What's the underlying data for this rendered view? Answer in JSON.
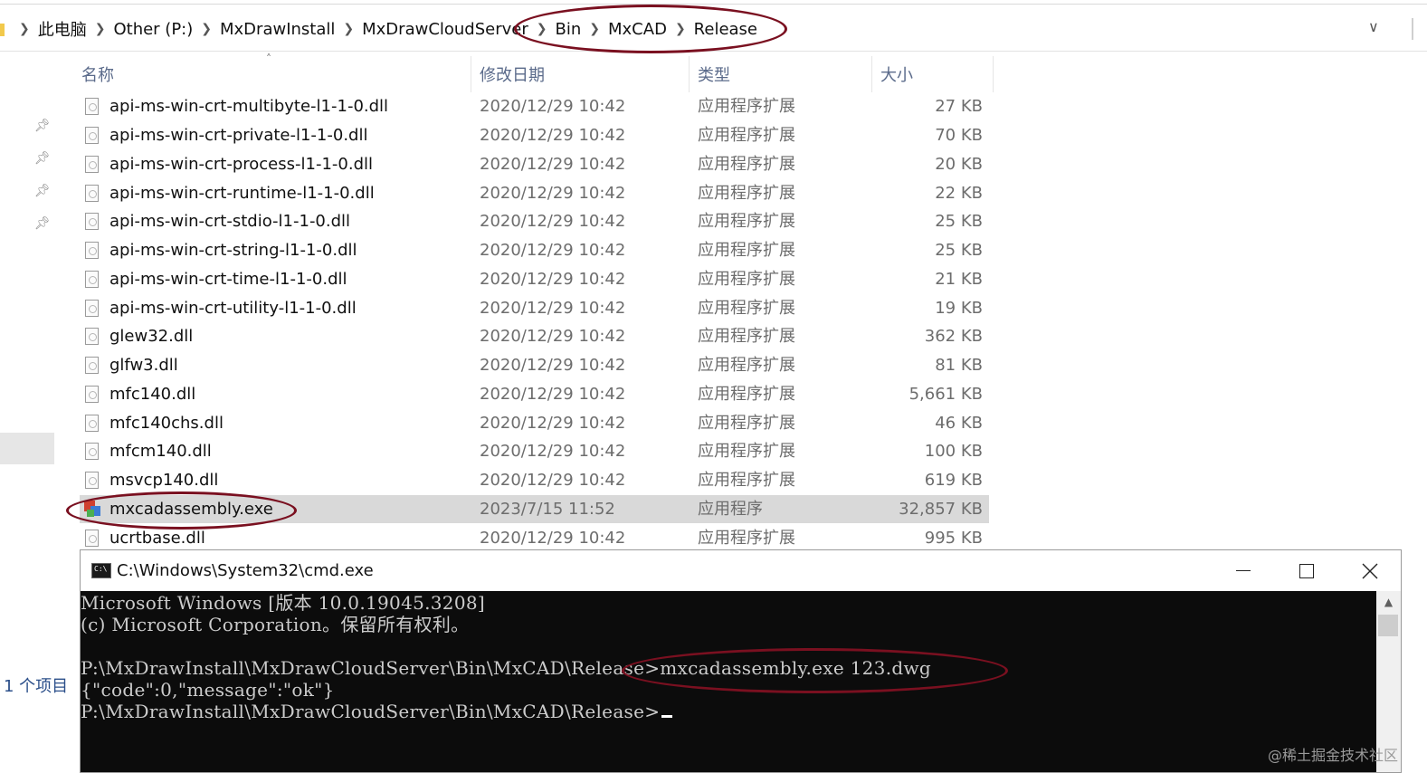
{
  "explorer": {
    "breadcrumb": [
      "此电脑",
      "Other (P:)",
      "MxDrawInstall",
      "MxDrawCloudServer",
      "Bin",
      "MxCAD",
      "Release"
    ],
    "columns": {
      "name": "名称",
      "date": "修改日期",
      "type": "类型",
      "size": "大小"
    },
    "files": [
      {
        "name": "api-ms-win-crt-multibyte-l1-1-0.dll",
        "date": "2020/12/29 10:42",
        "type": "应用程序扩展",
        "size": "27 KB"
      },
      {
        "name": "api-ms-win-crt-private-l1-1-0.dll",
        "date": "2020/12/29 10:42",
        "type": "应用程序扩展",
        "size": "70 KB"
      },
      {
        "name": "api-ms-win-crt-process-l1-1-0.dll",
        "date": "2020/12/29 10:42",
        "type": "应用程序扩展",
        "size": "20 KB"
      },
      {
        "name": "api-ms-win-crt-runtime-l1-1-0.dll",
        "date": "2020/12/29 10:42",
        "type": "应用程序扩展",
        "size": "22 KB"
      },
      {
        "name": "api-ms-win-crt-stdio-l1-1-0.dll",
        "date": "2020/12/29 10:42",
        "type": "应用程序扩展",
        "size": "25 KB"
      },
      {
        "name": "api-ms-win-crt-string-l1-1-0.dll",
        "date": "2020/12/29 10:42",
        "type": "应用程序扩展",
        "size": "25 KB"
      },
      {
        "name": "api-ms-win-crt-time-l1-1-0.dll",
        "date": "2020/12/29 10:42",
        "type": "应用程序扩展",
        "size": "21 KB"
      },
      {
        "name": "api-ms-win-crt-utility-l1-1-0.dll",
        "date": "2020/12/29 10:42",
        "type": "应用程序扩展",
        "size": "19 KB"
      },
      {
        "name": "glew32.dll",
        "date": "2020/12/29 10:42",
        "type": "应用程序扩展",
        "size": "362 KB"
      },
      {
        "name": "glfw3.dll",
        "date": "2020/12/29 10:42",
        "type": "应用程序扩展",
        "size": "81 KB"
      },
      {
        "name": "mfc140.dll",
        "date": "2020/12/29 10:42",
        "type": "应用程序扩展",
        "size": "5,661 KB"
      },
      {
        "name": "mfc140chs.dll",
        "date": "2020/12/29 10:42",
        "type": "应用程序扩展",
        "size": "46 KB"
      },
      {
        "name": "mfcm140.dll",
        "date": "2020/12/29 10:42",
        "type": "应用程序扩展",
        "size": "100 KB"
      },
      {
        "name": "msvcp140.dll",
        "date": "2020/12/29 10:42",
        "type": "应用程序扩展",
        "size": "619 KB"
      },
      {
        "name": "mxcadassembly.exe",
        "date": "2023/7/15 11:52",
        "type": "应用程序",
        "size": "32,857 KB",
        "selected": true
      },
      {
        "name": "ucrtbase.dll",
        "date": "2020/12/29 10:42",
        "type": "应用程序扩展",
        "size": "995 KB"
      }
    ],
    "status": "1 个项目"
  },
  "cmd": {
    "title": "C:\\Windows\\System32\\cmd.exe",
    "lines": [
      "Microsoft Windows [版本 10.0.19045.3208]",
      "(c) Microsoft Corporation。保留所有权利。",
      "",
      "P:\\MxDrawInstall\\MxDrawCloudServer\\Bin\\MxCAD\\Release>mxcadassembly.exe 123.dwg",
      "{\"code\":0,\"message\":\"ok\"}",
      "P:\\MxDrawInstall\\MxDrawCloudServer\\Bin\\MxCAD\\Release>"
    ]
  },
  "watermark": "@稀土掘金技术社区",
  "colors": {
    "annotation_ellipse": "#7a1020",
    "selected_row": "#d9d9d9",
    "console_bg": "#0c0c0c",
    "console_text": "#cccccc"
  }
}
